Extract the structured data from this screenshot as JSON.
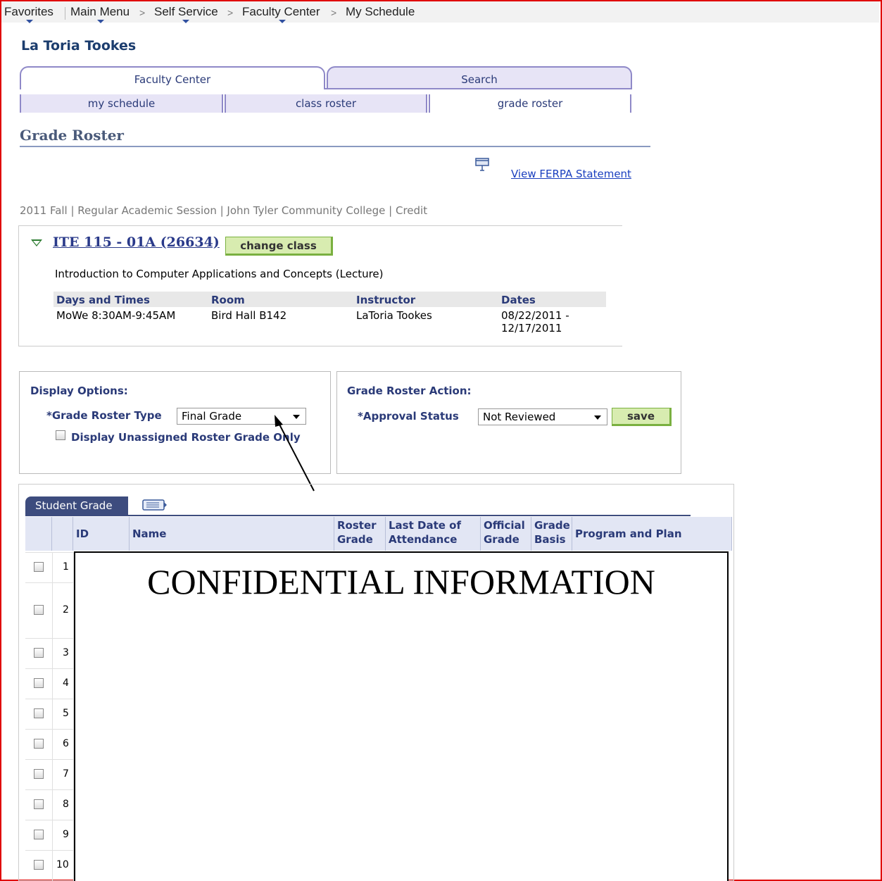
{
  "breadcrumb": {
    "favorites": "Favorites",
    "main_menu": "Main Menu",
    "self_service": "Self Service",
    "faculty_center": "Faculty Center",
    "current": "My Schedule",
    "separator": ">"
  },
  "user_name": "La Toria Tookes",
  "tabs": [
    {
      "label": "Faculty Center",
      "active": true
    },
    {
      "label": "Search",
      "active": false
    }
  ],
  "subtabs": [
    {
      "label": "my schedule",
      "active": false
    },
    {
      "label": "class roster",
      "active": false
    },
    {
      "label": "grade roster",
      "active": true
    }
  ],
  "page_title": "Grade Roster",
  "ferpa_link": "View FERPA Statement",
  "term_line": "2011 Fall | Regular Academic Session | John Tyler Community College | Credit",
  "class": {
    "title": "ITE 115 - 01A (26634)",
    "change_button": "change class",
    "description": "Introduction to Computer Applications and Concepts (Lecture)",
    "headers": {
      "days_times": "Days and Times",
      "room": "Room",
      "instructor": "Instructor",
      "dates": "Dates"
    },
    "meeting": {
      "days_times": "MoWe 8:30AM-9:45AM",
      "room": "Bird Hall B142",
      "instructor": "LaToria Tookes",
      "dates_line1": "08/22/2011 -",
      "dates_line2": "12/17/2011"
    }
  },
  "display_options": {
    "heading": "Display Options:",
    "roster_type_label": "*Grade Roster Type",
    "roster_type_value": "Final Grade",
    "unassigned_label": "Display Unassigned Roster Grade Only"
  },
  "roster_action": {
    "heading": "Grade Roster Action:",
    "approval_label": "*Approval Status",
    "approval_value": "Not Reviewed",
    "save_button": "save"
  },
  "grid": {
    "tab_label": "Student Grade",
    "headers": {
      "id": "ID",
      "name": "Name",
      "roster_grade_1": "Roster",
      "roster_grade_2": "Grade",
      "last_date_1": "Last Date of",
      "last_date_2": "Attendance",
      "official_1": "Official",
      "official_2": "Grade",
      "basis_1": "Grade",
      "basis_2": "Basis",
      "program": "Program and Plan"
    },
    "row_numbers": [
      "1",
      "2",
      "3",
      "4",
      "5",
      "6",
      "7",
      "8",
      "9",
      "10"
    ]
  },
  "confidential_text": "CONFIDENTIAL INFORMATION",
  "colors": {
    "accent": "#2a3a78",
    "frame": "#e00000",
    "tab_bg": "#e7e4f6",
    "green_button": "#d8ecb0"
  }
}
